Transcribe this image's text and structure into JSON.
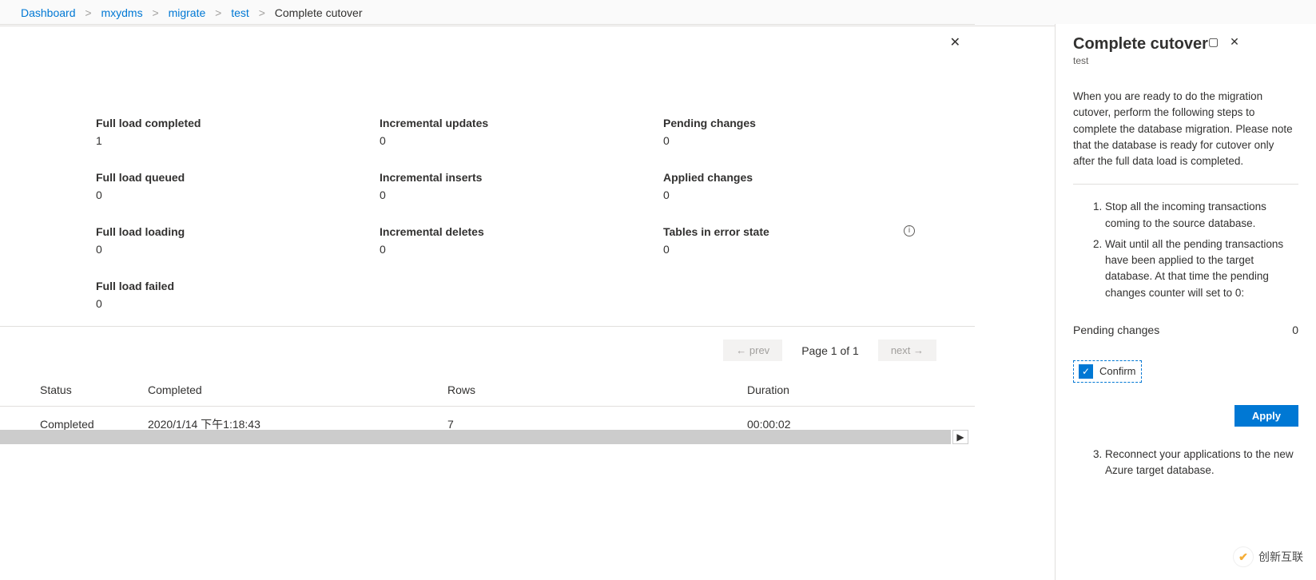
{
  "breadcrumb": {
    "items": [
      "Dashboard",
      "mxydms",
      "migrate",
      "test"
    ],
    "current": "Complete cutover"
  },
  "stats": {
    "full_load_completed": {
      "label": "Full load completed",
      "value": "1"
    },
    "full_load_queued": {
      "label": "Full load queued",
      "value": "0"
    },
    "full_load_loading": {
      "label": "Full load loading",
      "value": "0"
    },
    "full_load_failed": {
      "label": "Full load failed",
      "value": "0"
    },
    "incremental_updates": {
      "label": "Incremental updates",
      "value": "0"
    },
    "incremental_inserts": {
      "label": "Incremental inserts",
      "value": "0"
    },
    "incremental_deletes": {
      "label": "Incremental deletes",
      "value": "0"
    },
    "pending_changes": {
      "label": "Pending changes",
      "value": "0"
    },
    "applied_changes": {
      "label": "Applied changes",
      "value": "0"
    },
    "tables_in_error": {
      "label": "Tables in error state",
      "value": "0"
    }
  },
  "pager": {
    "prev": "← prev",
    "text": "Page 1 of 1",
    "next": "next →"
  },
  "table": {
    "headers": {
      "status": "Status",
      "completed": "Completed",
      "rows": "Rows",
      "duration": "Duration"
    },
    "row": {
      "status": "Completed",
      "completed": "2020/1/14 下午1:18:43",
      "rows": "7",
      "duration": "00:00:02"
    }
  },
  "panel": {
    "title": "Complete cutover",
    "subtitle": "test",
    "description": "When you are ready to do the migration cutover, perform the following steps to complete the database migration. Please note that the database is ready for cutover only after the full data load is completed.",
    "step1": "Stop all the incoming transactions coming to the source database.",
    "step2": "Wait until all the pending transactions have been applied to the target database. At that time the pending changes counter will set to 0:",
    "pending_label": "Pending changes",
    "pending_value": "0",
    "confirm_label": "Confirm",
    "apply_label": "Apply",
    "step3": "Reconnect your applications to the new Azure target database."
  },
  "watermark": "创新互联"
}
